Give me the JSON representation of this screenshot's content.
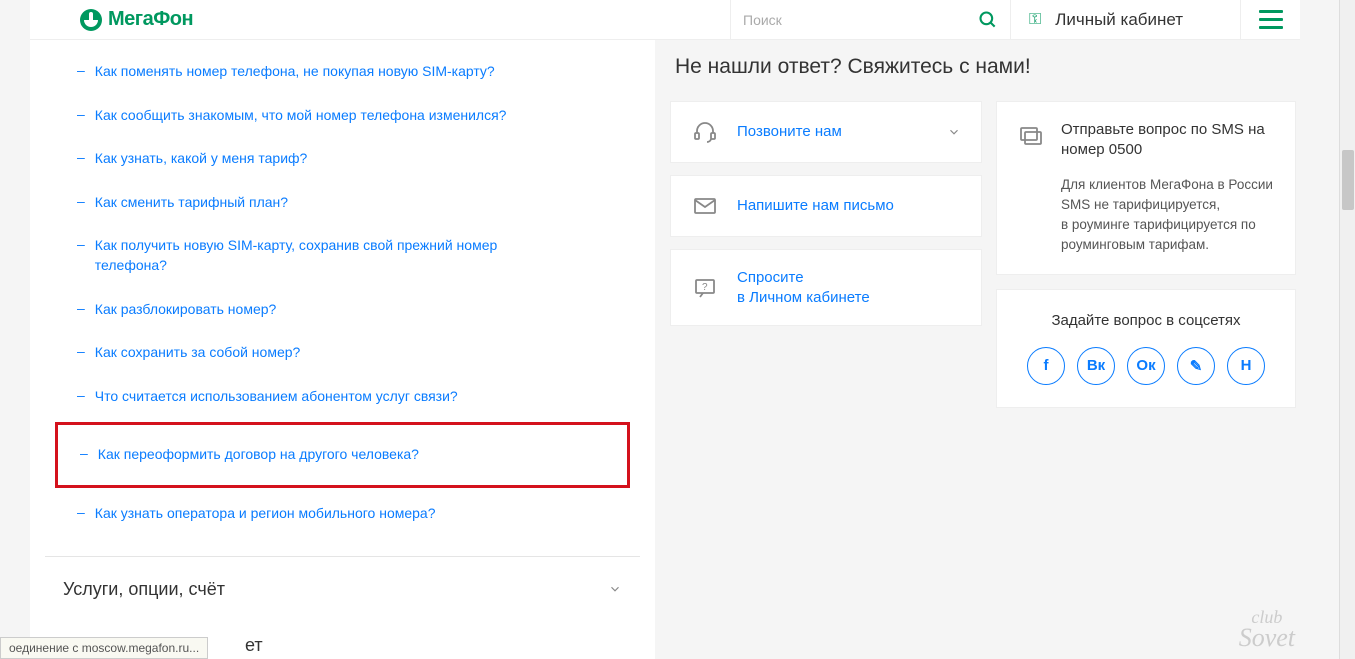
{
  "header": {
    "brand": "МегаФон",
    "search_placeholder": "Поиск",
    "cabinet": "Личный кабинет"
  },
  "faq": [
    {
      "text": "Как поменять номер телефона, не покупая новую SIM-карту?",
      "highlight": false
    },
    {
      "text": "Как сообщить знакомым, что мой номер телефона изменился?",
      "highlight": false
    },
    {
      "text": "Как узнать, какой у меня тариф?",
      "highlight": false
    },
    {
      "text": "Как сменить тарифный план?",
      "highlight": false
    },
    {
      "text": "Как получить новую SIM-карту, сохранив свой прежний номер телефона?",
      "highlight": false
    },
    {
      "text": "Как разблокировать номер?",
      "highlight": false
    },
    {
      "text": "Как сохранить за собой номер?",
      "highlight": false
    },
    {
      "text": "Что считается использованием абонентом услуг связи?",
      "highlight": false
    },
    {
      "text": "Как переоформить договор на другого человека?",
      "highlight": true
    },
    {
      "text": "Как узнать оператора и регион мобильного номера?",
      "highlight": false
    }
  ],
  "accordion": {
    "services": "Услуги, опции, счёт",
    "next_partial": "ет"
  },
  "aside": {
    "title": "Не нашли ответ? Свяжитесь с нами!",
    "contacts": {
      "call": "Позвоните нам",
      "write": "Напишите нам письмо",
      "ask": "Спросите\nв Личном кабинете"
    },
    "sms": {
      "title": "Отправьте вопрос по SMS на номер 0500",
      "body": "Для клиентов МегаФона в России SMS не тарифицируется,\nв роуминге тарифицируется по роуминговым тарифам."
    },
    "social": {
      "title": "Задайте вопрос в соцсетях",
      "items": [
        "f",
        "Вк",
        "Ок",
        "✎",
        "Н"
      ]
    }
  },
  "statusbar": "оединение с moscow.megafon.ru...",
  "watermark": {
    "l1": "club",
    "l2": "Sovet"
  }
}
